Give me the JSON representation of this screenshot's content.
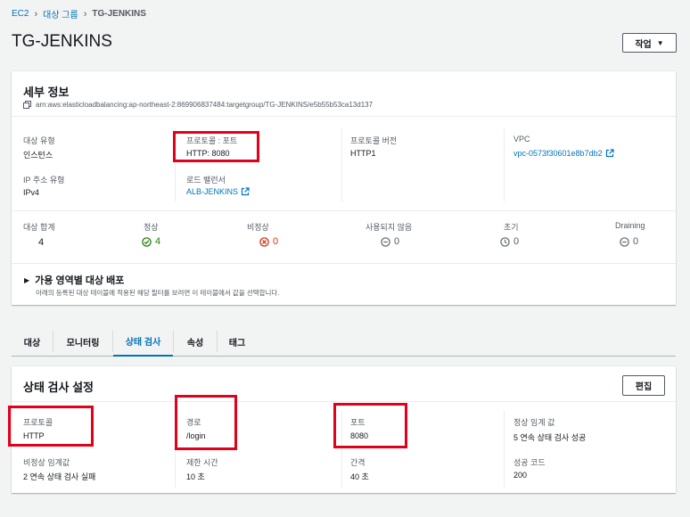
{
  "breadcrumb": {
    "items": [
      "EC2",
      "대상 그룹"
    ],
    "current": "TG-JENKINS"
  },
  "page": {
    "title": "TG-JENKINS",
    "actions_label": "작업"
  },
  "details": {
    "heading": "세부 정보",
    "arn": "arn:aws:elasticloadbalancing:ap-northeast-2:869906837484:targetgroup/TG-JENKINS/e5b55b53ca13d137",
    "target_type": {
      "label": "대상 유형",
      "value": "인스턴스"
    },
    "protocol_port": {
      "label": "프로토콜 : 포트",
      "value": "HTTP: 8080"
    },
    "protocol_version": {
      "label": "프로토콜 버전",
      "value": "HTTP1"
    },
    "vpc": {
      "label": "VPC",
      "value": "vpc-0573f30601e8b7db2"
    },
    "ip_type": {
      "label": "IP 주소 유형",
      "value": "IPv4"
    },
    "load_balancer": {
      "label": "로드 밸런서",
      "value": "ALB-JENKINS"
    }
  },
  "stats": {
    "total": {
      "label": "대상 합계",
      "value": "4"
    },
    "healthy": {
      "label": "정상",
      "value": "4"
    },
    "unhealthy": {
      "label": "비정상",
      "value": "0"
    },
    "unused": {
      "label": "사용되지 않음",
      "value": "0"
    },
    "initial": {
      "label": "초기",
      "value": "0"
    },
    "draining": {
      "label": "Draining",
      "value": "0"
    }
  },
  "az": {
    "title": "가용 영역별 대상 배포",
    "desc": "아래의 등록된 대상 테이블에 적용된 해당 필터를 보려면 이 테이블에서 값을 선택합니다."
  },
  "tabs": [
    "대상",
    "모니터링",
    "상태 검사",
    "속성",
    "태그"
  ],
  "health": {
    "heading": "상태 검사 설정",
    "edit_label": "편집",
    "protocol": {
      "label": "프로토콜",
      "value": "HTTP"
    },
    "path": {
      "label": "경로",
      "value": "/login"
    },
    "port": {
      "label": "포트",
      "value": "8080"
    },
    "healthy_threshold": {
      "label": "정상 임계 값",
      "value": "5 연속 상태 검사 성공"
    },
    "unhealthy_threshold": {
      "label": "비정상 임계값",
      "value": "2 연속 상태 검사 실패"
    },
    "timeout": {
      "label": "제한 시간",
      "value": "10 초"
    },
    "interval": {
      "label": "간격",
      "value": "40 초"
    },
    "success_codes": {
      "label": "성공 코드",
      "value": "200"
    }
  },
  "colors": {
    "link": "#0073bb",
    "healthy": "#1d8102",
    "unhealthy": "#d13212",
    "neutral": "#687078",
    "highlight": "#e3001b"
  }
}
